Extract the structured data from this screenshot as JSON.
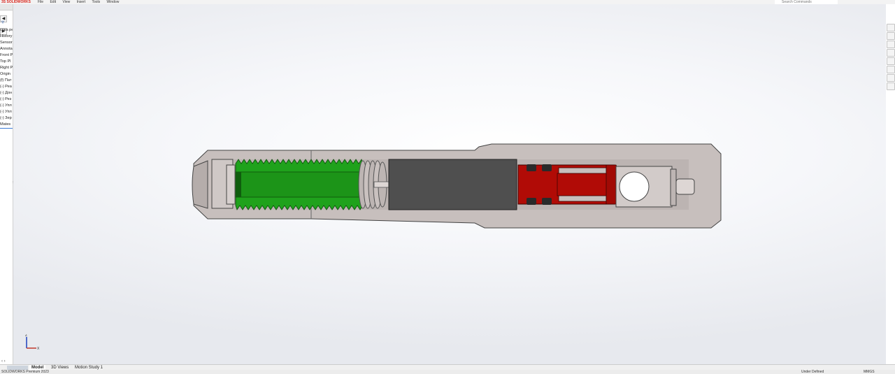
{
  "app": {
    "logo_text": "3S SOLIDWORKS",
    "menus": [
      "File",
      "Edit",
      "View",
      "Insert",
      "Tools",
      "Window"
    ],
    "search_placeholder": "Search Commands"
  },
  "feature_tree": {
    "filter_icon": "filter-icon",
    "items": [
      "срка ре",
      "History",
      "Sensors",
      "Annota",
      "Front P",
      "Top Pl",
      "Right P",
      "Origin",
      "(f) Пат",
      "(-) Реа",
      "(-) Дон",
      "(-) Рез",
      "(-) Упл",
      "(-) Упл",
      "(-) Зер",
      "Mates"
    ]
  },
  "bottom_tabs": {
    "model": "Model",
    "views3d": "3D Views",
    "motion": "Motion Study 1"
  },
  "status_bar": {
    "left": "SOLIDWORKS Premium 2023",
    "center": "Under Defined",
    "units": "MMGS"
  },
  "triad": {
    "y_label": "Z",
    "x_label": "X"
  },
  "colors": {
    "body": "#c7bfbd",
    "thread_green": "#1fa21c",
    "piston_red": "#b10b06",
    "core_gray": "#4f4f4f",
    "accent": "#3a7bd5"
  }
}
